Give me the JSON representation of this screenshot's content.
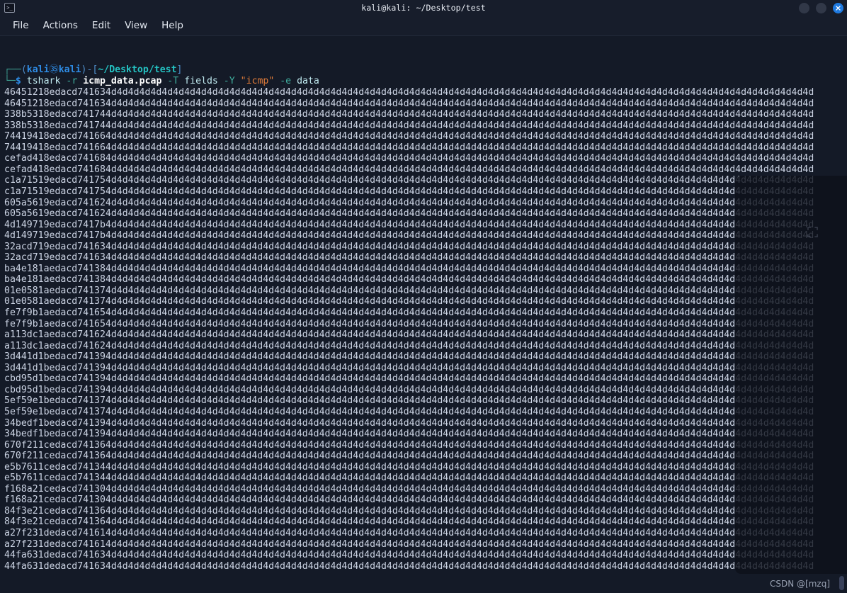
{
  "window": {
    "title": "kali@kali: ~/Desktop/test",
    "icon": "terminal-icon",
    "buttons": [
      {
        "name": "minimize-button",
        "label": ""
      },
      {
        "name": "maximize-button",
        "label": ""
      },
      {
        "name": "close-button",
        "label": "×"
      }
    ]
  },
  "menu": {
    "items": [
      {
        "label": "File"
      },
      {
        "label": "Actions"
      },
      {
        "label": "Edit"
      },
      {
        "label": "View"
      },
      {
        "label": "Help"
      }
    ]
  },
  "prompt": {
    "line1_frame": "┌──",
    "open_paren": "(",
    "user": "kali",
    "at": "㉟",
    "host": "kali",
    "close_paren": ")",
    "dash": "-",
    "open_bracket": "[",
    "path": "~/Desktop/test",
    "close_bracket": "]",
    "line2_frame": "└─",
    "dollar": "$"
  },
  "command": {
    "name": "tshark",
    "flag_r": "-r",
    "file": "icmp_data.pcap",
    "flag_T": "-T",
    "arg_fields": "fields",
    "flag_Y": "-Y",
    "filter": "\"icmp\"",
    "flag_e": "-e",
    "arg_data": "data"
  },
  "output": {
    "pad": "4d",
    "pad_repeat": 63,
    "lines": [
      "46451218edacd74163",
      "46451218edacd74163",
      "338b5318edacd74174",
      "338b5318edacd74174",
      "74419418edacd74166",
      "74419418edacd74166",
      "cefad418edacd74168",
      "cefad418edacd74168",
      "c1a71519edacd74175",
      "c1a71519edacd74175",
      "605a5619edacd74162",
      "605a5619edacd74162",
      "4d149719edacd7417b",
      "4d149719edacd7417b",
      "32acd719edacd74163",
      "32acd719edacd74163",
      "ba4e181aedacd74138",
      "ba4e181aedacd74138",
      "01e0581aedacd74137",
      "01e0581aedacd74137",
      "fe7f9b1aedacd74165",
      "fe7f9b1aedacd74165",
      "a113dc1aedacd74162",
      "a113dc1aedacd74162",
      "3d441d1bedacd74139",
      "3d441d1bedacd74139",
      "cbd95d1bedacd74139",
      "cbd95d1bedacd74139",
      "5ef59e1bedacd74137",
      "5ef59e1bedacd74137",
      "34bedf1bedacd74139",
      "34bedf1bedacd74139",
      "670f211cedacd74136",
      "670f211cedacd74136",
      "e5b7611cedacd74134",
      "e5b7611cedacd74134",
      "f168a21cedacd74130",
      "f168a21cedacd74130",
      "84f3e21cedacd74136",
      "84f3e21cedacd74136",
      "a27f231dedacd74161",
      "a27f231dedacd74161",
      "44fa631dedacd74163",
      "44fa631dedacd74163"
    ]
  },
  "overlay": {
    "expand_icon": "fullscreen-expand-icon"
  },
  "watermark": {
    "text": "CSDN @[mzq]"
  }
}
